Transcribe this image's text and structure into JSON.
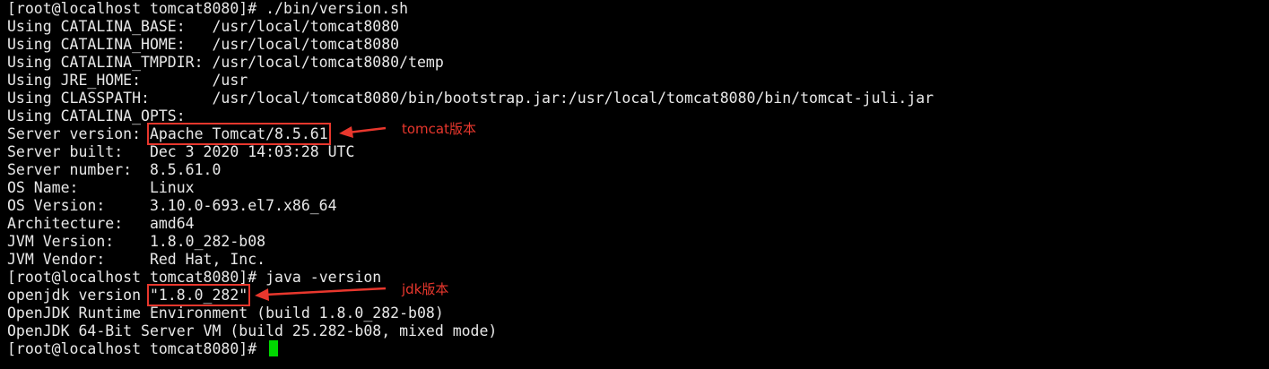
{
  "terminal": {
    "lines": [
      {
        "prompt": "[root@localhost tomcat8080]# ",
        "text": "./bin/version.sh"
      },
      {
        "text": "Using CATALINA_BASE:   /usr/local/tomcat8080"
      },
      {
        "text": "Using CATALINA_HOME:   /usr/local/tomcat8080"
      },
      {
        "text": "Using CATALINA_TMPDIR: /usr/local/tomcat8080/temp"
      },
      {
        "text": "Using JRE_HOME:        /usr"
      },
      {
        "text": "Using CLASSPATH:       /usr/local/tomcat8080/bin/bootstrap.jar:/usr/local/tomcat8080/bin/tomcat-juli.jar"
      },
      {
        "text": "Using CATALINA_OPTS:"
      },
      {
        "text": "Server version: ",
        "highlight": "Apache Tomcat/8.5.61"
      },
      {
        "text": "Server built:   Dec 3 2020 14:03:28 UTC"
      },
      {
        "text": "Server number:  8.5.61.0"
      },
      {
        "text": "OS Name:        Linux"
      },
      {
        "text": "OS Version:     3.10.0-693.el7.x86_64"
      },
      {
        "text": "Architecture:   amd64"
      },
      {
        "text": "JVM Version:    1.8.0_282-b08"
      },
      {
        "text": "JVM Vendor:     Red Hat, Inc."
      },
      {
        "prompt": "[root@localhost tomcat8080]# ",
        "text": "java -version"
      },
      {
        "text": "openjdk version ",
        "highlight": "\"1.8.0_282\""
      },
      {
        "text": "OpenJDK Runtime Environment (build 1.8.0_282-b08)"
      },
      {
        "text": "OpenJDK 64-Bit Server VM (build 25.282-b08, mixed mode)"
      },
      {
        "prompt": "[root@localhost tomcat8080]# ",
        "text": ""
      }
    ]
  },
  "annotations": {
    "tomcat_label": "tomcat版本",
    "jdk_label": "jdk版本"
  },
  "colors": {
    "background": "#000000",
    "text": "#e8e8e8",
    "annotation": "#e8372d",
    "cursor": "#00d800"
  },
  "icons": {
    "cursor": "block-cursor",
    "arrows": "red-arrow-icon"
  }
}
